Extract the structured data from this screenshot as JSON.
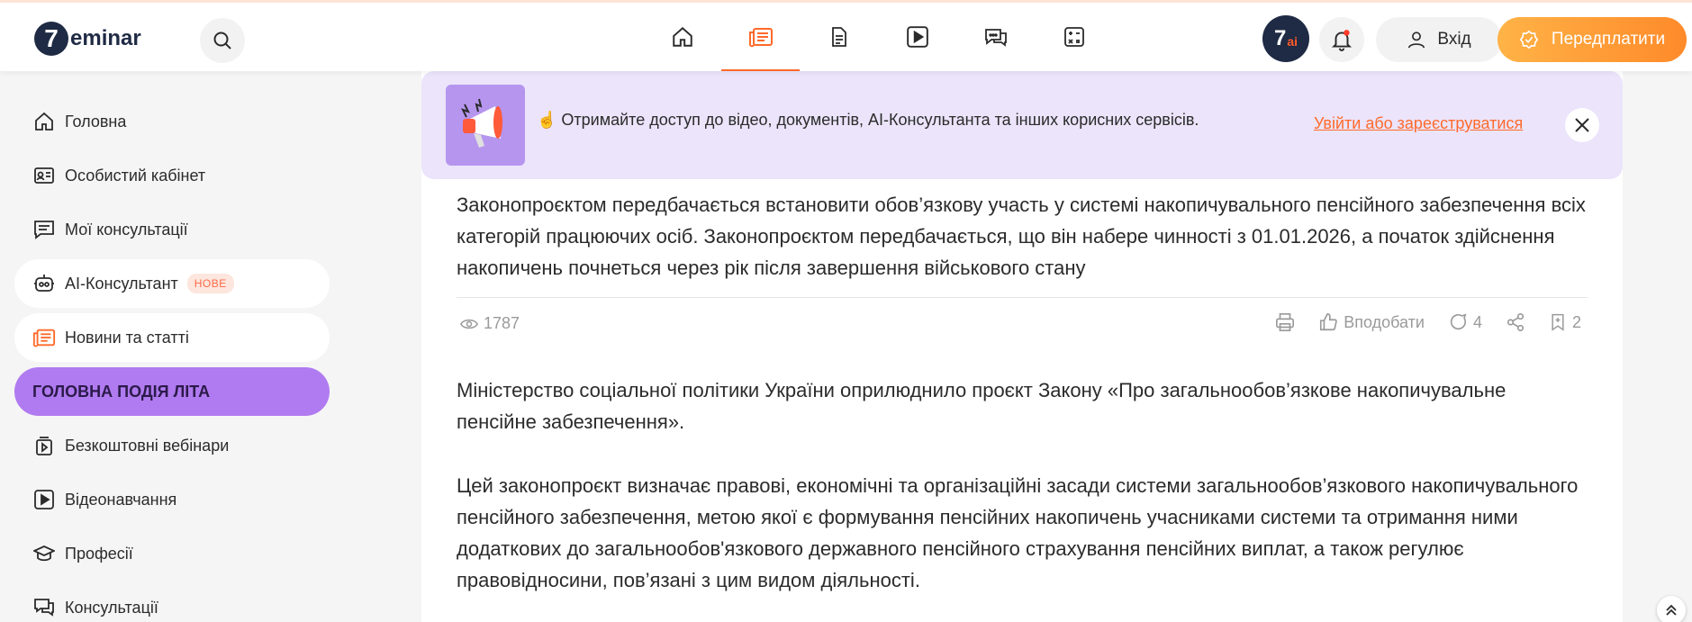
{
  "brand": {
    "logo_digit": "7",
    "logo_text": "eminar"
  },
  "header": {
    "nav_icons": [
      "home-icon",
      "news-icon",
      "document-icon",
      "video-icon",
      "chat-icon",
      "calculator-icon"
    ],
    "active_nav": "news-icon",
    "ai_badge_main": "7",
    "ai_badge_sub": "ai",
    "login_label": "Вхід",
    "subscribe_label": "Передплатити"
  },
  "sidebar": {
    "items": [
      {
        "label": "Головна",
        "icon": "home-icon"
      },
      {
        "label": "Особистий кабінет",
        "icon": "id-card-icon"
      },
      {
        "label": "Мої консультації",
        "icon": "message-lines-icon"
      },
      {
        "label": "AI-Консультант",
        "icon": "robot-icon",
        "badge": "НОВЕ"
      },
      {
        "label": "Новини та статті",
        "icon": "news-icon"
      },
      {
        "label": "ГОЛОВНА ПОДІЯ ЛІТА"
      },
      {
        "label": "Безкоштовні вебінари",
        "icon": "webinar-icon"
      },
      {
        "label": "Відеонавчання",
        "icon": "video-icon"
      },
      {
        "label": "Професії",
        "icon": "graduation-icon"
      },
      {
        "label": "Консультації",
        "icon": "consult-icon"
      }
    ]
  },
  "banner": {
    "text": "☝ Отримайте доступ до відео, документів, AI-Консультанта та інших корисних сервісів.",
    "link": "Увійти або зареєструватися"
  },
  "article": {
    "lead": "Законопроєктом передбачається встановити обов’язкову участь у системі накопичувального пенсійного забезпечення всіх категорій працюючих осіб. Законопроєктом передбачається, що він набере чинності з 01.01.2026, а початок здійснення накопичень почнеться через рік після завершення військового стану",
    "views": "1787",
    "like_label": "Вподобати",
    "comments": "4",
    "bookmarks": "2",
    "para1": "Міністерство соціальної політики України оприлюднило проєкт Закону «Про загальнообов’язкове накопичувальне пенсійне забезпечення».",
    "para2": "Цей законопроєкт визначає правові, економічні та організаційні засади системи загальнообов’язкового накопичувального пенсійного забезпечення, метою якої є формування пенсійних накопичень учасниками системи та отримання ними додаткових до загальнообов'язкового державного пенсійного страхування пенсійних виплат, а також регулює правовідносини, пов’язані з цим видом діяльності."
  },
  "colors": {
    "accent": "#ff6a2b",
    "highlight": "#b07bf0",
    "banner_bg": "#ebe4fb"
  }
}
